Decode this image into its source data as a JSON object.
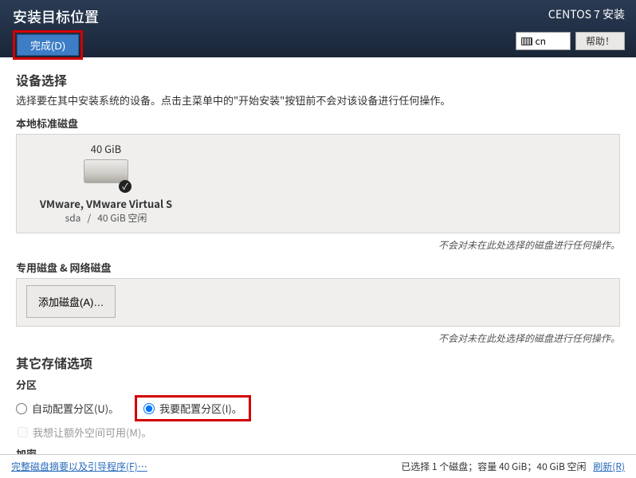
{
  "header": {
    "page_title": "安装目标位置",
    "done_button": "完成(D)",
    "installer_title": "CENTOS 7 安装",
    "keyboard": "cn",
    "help_button": "帮助！"
  },
  "device_section": {
    "title": "设备选择",
    "description": "选择要在其中安装系统的设备。点击主菜单中的\"开始安装\"按钮前不会对该设备进行任何操作。",
    "local_disks_title": "本地标准磁盘",
    "disk": {
      "size": "40 GiB",
      "name": "VMware, VMware Virtual S",
      "device": "sda",
      "sep": "/",
      "free": "40 GiB 空闲"
    },
    "note": "不会对未在此处选择的磁盘进行任何操作。",
    "special_title": "专用磁盘 & 网络磁盘",
    "add_disk_button": "添加磁盘(A)…"
  },
  "storage_section": {
    "title": "其它存储选项",
    "partition_title": "分区",
    "auto_label": "自动配置分区(U)。",
    "manual_label": "我要配置分区(I)。",
    "extra_space_label": "我想让额外空间可用(M)。",
    "encryption_title": "加密"
  },
  "footer": {
    "summary_link": "完整磁盘摘要以及引导程序(F)…",
    "status": "已选择 1 个磁盘；容量 40 GiB；40 GiB 空闲",
    "refresh": "刷新(R)"
  }
}
